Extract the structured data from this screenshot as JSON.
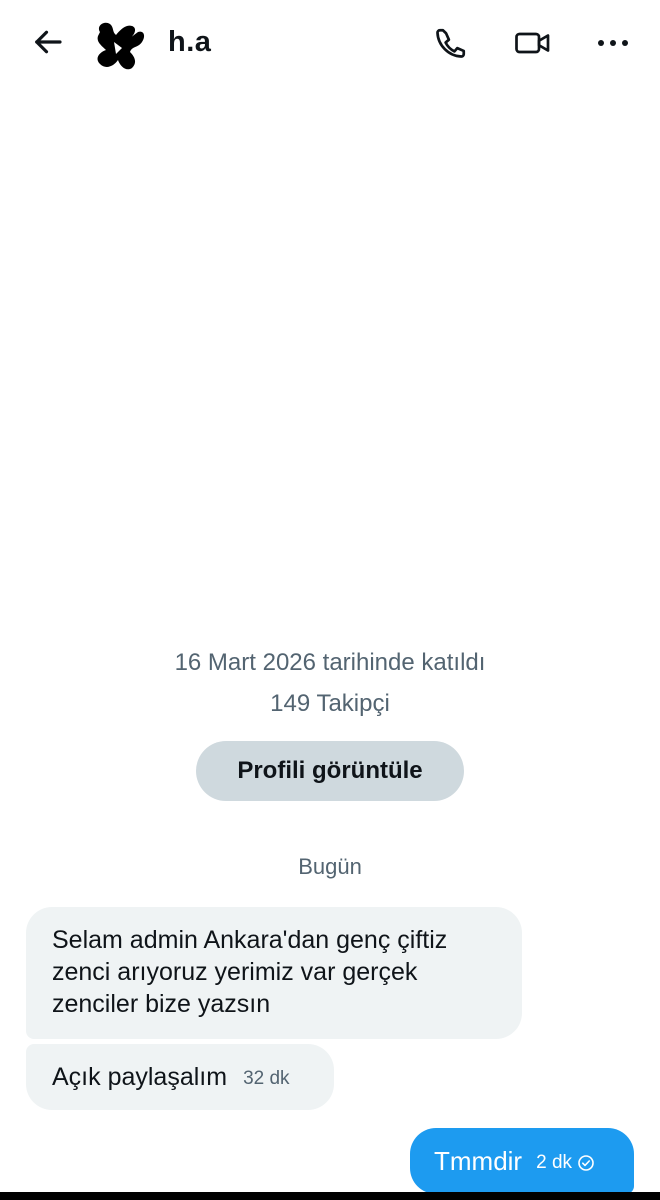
{
  "header": {
    "back_icon": "arrow-left-icon",
    "contact_name": "h.a",
    "call_icon": "phone-icon",
    "video_icon": "video-camera-icon",
    "more_icon": "more-horizontal-icon"
  },
  "profile": {
    "joined": "16 Mart 2026 tarihinde katıldı",
    "followers": "149 Takipçi",
    "view_profile_label": "Profili görüntüle"
  },
  "conversation": {
    "day_label": "Bugün",
    "messages": [
      {
        "direction": "incoming",
        "text": "Selam admin Ankara'dan genç çiftiz zenci arıyoruz yerimiz var gerçek zenciler bize yazsın",
        "time": ""
      },
      {
        "direction": "incoming",
        "text": "Açık paylaşalım",
        "time": "32 dk"
      },
      {
        "direction": "outgoing",
        "text": "Tmmdir",
        "time": "2 dk",
        "status_icon": "sent-check-circle-icon"
      }
    ]
  },
  "colors": {
    "accent": "#1d9bf0",
    "incoming_bubble": "#eff3f4",
    "secondary_text": "#536471",
    "button_bg": "#cfd9de"
  }
}
